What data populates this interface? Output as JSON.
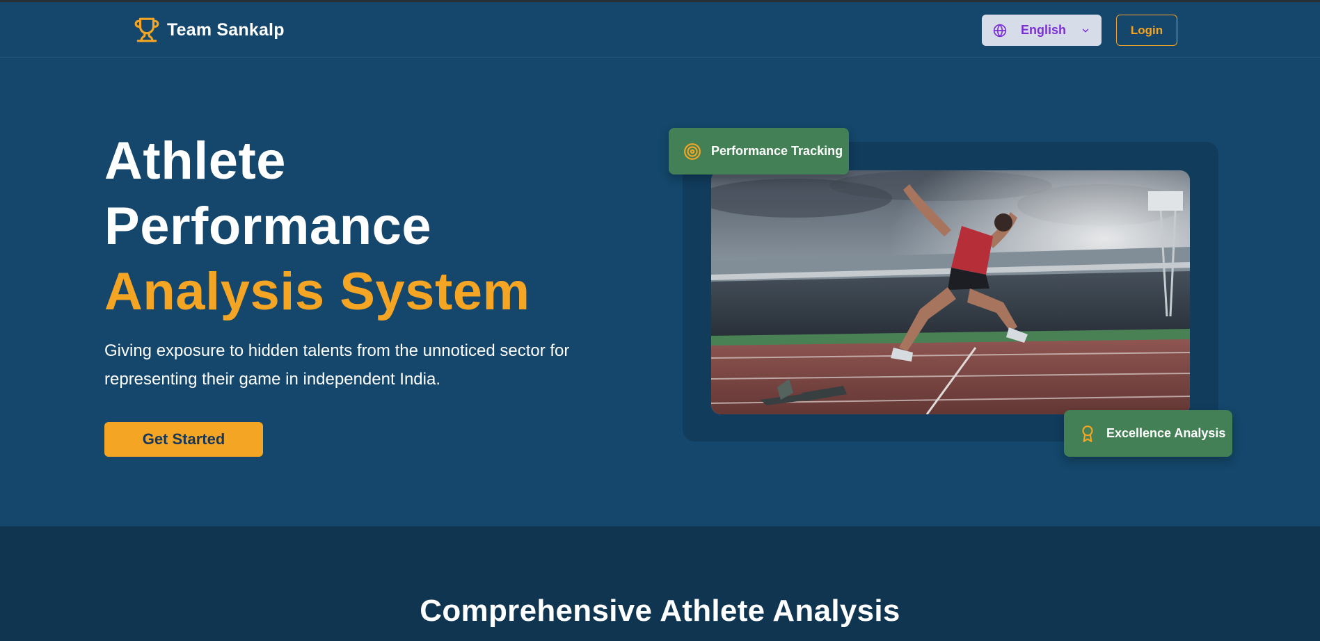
{
  "nav": {
    "brand": "Team Sankalp",
    "language": {
      "selected": "English"
    },
    "login_label": "Login"
  },
  "hero": {
    "title_line1": "Athlete",
    "title_line2": "Performance",
    "title_line3": "Analysis System",
    "subtitle": "Giving exposure to hidden talents from the unnoticed sector for representing their game in independent India.",
    "cta_label": "Get Started",
    "badges": {
      "top": {
        "label": "Performance Tracking",
        "icon": "target-icon"
      },
      "bottom": {
        "label": "Excellence Analysis",
        "icon": "award-icon"
      }
    }
  },
  "features": {
    "title": "Comprehensive Athlete Analysis"
  },
  "colors": {
    "background": "#14476b",
    "accent": "#f5a524",
    "badge": "#448055",
    "section_dark": "#103550",
    "language_text": "#7b2fd6"
  }
}
